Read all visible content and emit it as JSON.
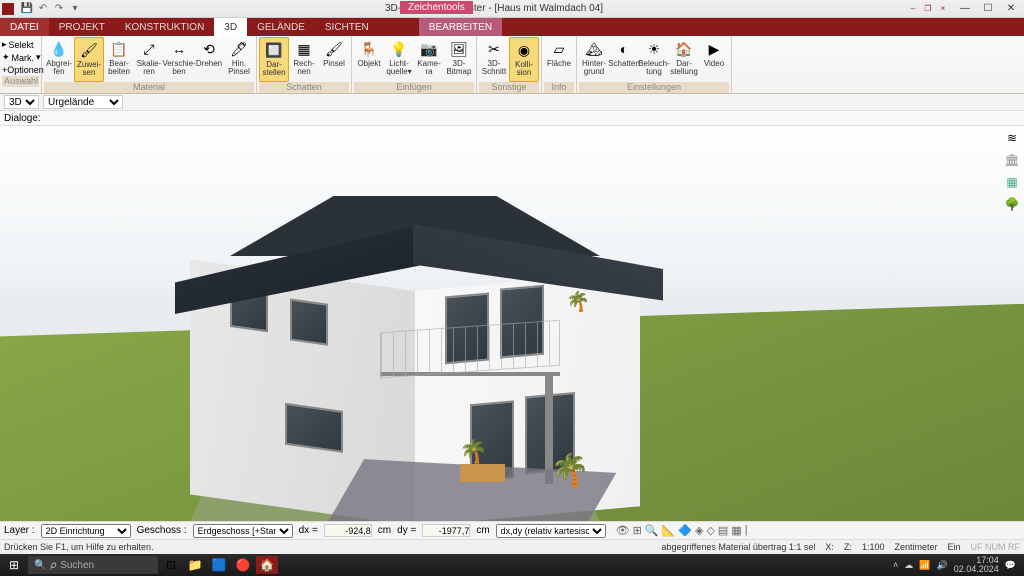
{
  "window": {
    "title": "3D-Hausplaner Master - [Haus mit Walmdach 04]",
    "context_tab": "Zeichentools"
  },
  "tabs": {
    "file": "DATEI",
    "items": [
      "PROJEKT",
      "KONSTRUKTION",
      "3D",
      "GELÄNDE",
      "SICHTEN",
      "BEARBEITEN"
    ],
    "active": "3D"
  },
  "ribbon": {
    "select": {
      "selekt": "Selekt",
      "mark": "Mark.",
      "optionen": "+Optionen",
      "label": "Auswahl"
    },
    "material": {
      "label": "Material",
      "btns": [
        {
          "t": "Abgrei-\nfen",
          "i": "💧"
        },
        {
          "t": "Zuwei-\nsen",
          "i": "🖌",
          "sel": true
        },
        {
          "t": "Bear-\nbeiten",
          "i": "📋"
        },
        {
          "t": "Skalie-\nren",
          "i": "⤢"
        },
        {
          "t": "Verschie-\nben",
          "i": "↔"
        },
        {
          "t": "Drehen",
          "i": "⟲"
        },
        {
          "t": "Hin.\nPinsel",
          "i": "🖊"
        }
      ]
    },
    "schatten": {
      "label": "Schatten",
      "btns": [
        {
          "t": "Dar-\nstellen",
          "i": "🔲",
          "sel": true
        },
        {
          "t": "Rech-\nnen",
          "i": "▦"
        },
        {
          "t": "Pinsel",
          "i": "🖌"
        }
      ]
    },
    "einfuegen": {
      "label": "Einfügen",
      "btns": [
        {
          "t": "Objekt",
          "i": "🪑"
        },
        {
          "t": "Licht-\nquelle▾",
          "i": "💡"
        },
        {
          "t": "Kame-\nra",
          "i": "📷"
        },
        {
          "t": "3D-\nBitmap",
          "i": "🖼"
        }
      ]
    },
    "sonstige": {
      "label": "Sonstige",
      "btns": [
        {
          "t": "3D-\nSchnitt",
          "i": "✂"
        },
        {
          "t": "Kolli-\nsion",
          "i": "◉",
          "sel": true
        }
      ]
    },
    "info": {
      "label": "Info",
      "btns": [
        {
          "t": "Fläche",
          "i": "▱"
        }
      ]
    },
    "einstellungen": {
      "label": "Einstellungen",
      "btns": [
        {
          "t": "Hinter-\ngrund",
          "i": "🏔"
        },
        {
          "t": "Schatten",
          "i": "◐"
        },
        {
          "t": "Beleuch-\ntung",
          "i": "☀"
        },
        {
          "t": "Dar-\nstellung",
          "i": "🏠"
        },
        {
          "t": "Video",
          "i": "▶"
        }
      ]
    }
  },
  "dropbar": {
    "view": "3D",
    "terrain": "Urgelände"
  },
  "dlg": {
    "label": "Dialoge:"
  },
  "layerbar": {
    "layer_lbl": "Layer :",
    "layer_val": "2D Einrichtung",
    "geschoss_lbl": "Geschoss :",
    "geschoss_val": "Erdgeschoss [+Stan",
    "dx_lbl": "dx =",
    "dx_val": "-924,8",
    "dy_lbl": "dy =",
    "dy_val": "-1977,7",
    "unit": "cm",
    "coord": "dx,dy (relativ kartesisch)"
  },
  "status": {
    "help": "Drücken Sie F1, um Hilfe zu erhalten.",
    "right": "abgegriffenes Material übertrag  1:1 sel",
    "x": "X:",
    "z": "Z:",
    "scale": "1:100",
    "unit": "Zentimeter",
    "ein": "Ein",
    "flags": "UF NUM RF"
  },
  "taskbar": {
    "search": "Suchen",
    "time": "17:04",
    "date": "02.04.2024"
  }
}
